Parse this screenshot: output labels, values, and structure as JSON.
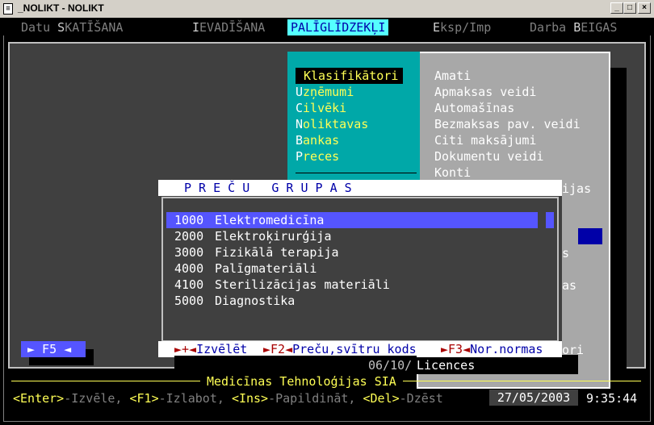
{
  "window": {
    "title": "_NOLIKT - NOLIKT",
    "controls": {
      "minimize": "_",
      "maximize": "□",
      "close": "×"
    }
  },
  "menubar": {
    "items": [
      {
        "pre": "Datu ",
        "hk": "S",
        "post": "KATĪŠANA"
      },
      {
        "pre": "",
        "hk": "I",
        "post": "EVADĪŠANA"
      },
      {
        "pre": "PAL",
        "hk": "Ī",
        "post": "GLĪDZEKĻI"
      },
      {
        "pre": "",
        "hk": "E",
        "post": "ksp/Imp"
      },
      {
        "pre": "Darba ",
        "hk": "B",
        "post": "EIGAS"
      }
    ]
  },
  "submenu1": {
    "items": [
      {
        "hk": "",
        "text": "Klasifikātori"
      },
      {
        "hk": "U",
        "text": "zņēmumi"
      },
      {
        "hk": "C",
        "text": "ilvēki"
      },
      {
        "hk": "N",
        "text": "oliktavas"
      },
      {
        "hk": "B",
        "text": "ankas"
      },
      {
        "hk": "P",
        "text": "reces"
      }
    ]
  },
  "submenu2": {
    "items": [
      {
        "hk": "A",
        "text": "mati"
      },
      {
        "hk": "A",
        "text": "pmaksas veidi"
      },
      {
        "hk": "A",
        "text": "utomašīnas"
      },
      {
        "hk": "B",
        "text": "ezmaksas pav. veidi"
      },
      {
        "hk": "C",
        "text": "iti maksājumi"
      },
      {
        "hk": "D",
        "text": "okumentu veidi"
      },
      {
        "hk": "K",
        "text": "onti"
      }
    ],
    "peeks": [
      "ijas",
      "s",
      "as",
      "ori"
    ],
    "licences": "Licences"
  },
  "dialog": {
    "title": "P R E Č U   G R U P A S",
    "rows": [
      {
        "code": "1000",
        "name": "Elektromedicīna"
      },
      {
        "code": "2000",
        "name": "Elektroķirurģija"
      },
      {
        "code": "3000",
        "name": "Fizikālā terapija"
      },
      {
        "code": "4000",
        "name": "Palīgmateriāli"
      },
      {
        "code": "4100",
        "name": "Sterilizācijas materiāli"
      },
      {
        "code": "5000",
        "name": "Diagnostika"
      }
    ],
    "footer": [
      {
        "key": "►+◄",
        "label": "Izvēlēt"
      },
      {
        "key": "►F2◄",
        "label": "Preču,svītru kods"
      },
      {
        "key": "►F3◄",
        "label": "Nor.normas"
      }
    ]
  },
  "f5_button": "► F5 ◄",
  "status": {
    "date_partial": "06/10/",
    "company": "Medicīnas Tehnoloģijas SIA",
    "hints": [
      {
        "key": "<Enter>",
        "text": "-Izvēle, "
      },
      {
        "key": "<F1>",
        "text": "-Izlabot, "
      },
      {
        "key": "<Ins>",
        "text": "-Papildināt, "
      },
      {
        "key": "<Del>",
        "text": "-Dzēst"
      }
    ],
    "date": "27/05/2003",
    "time": "9:35:44"
  }
}
